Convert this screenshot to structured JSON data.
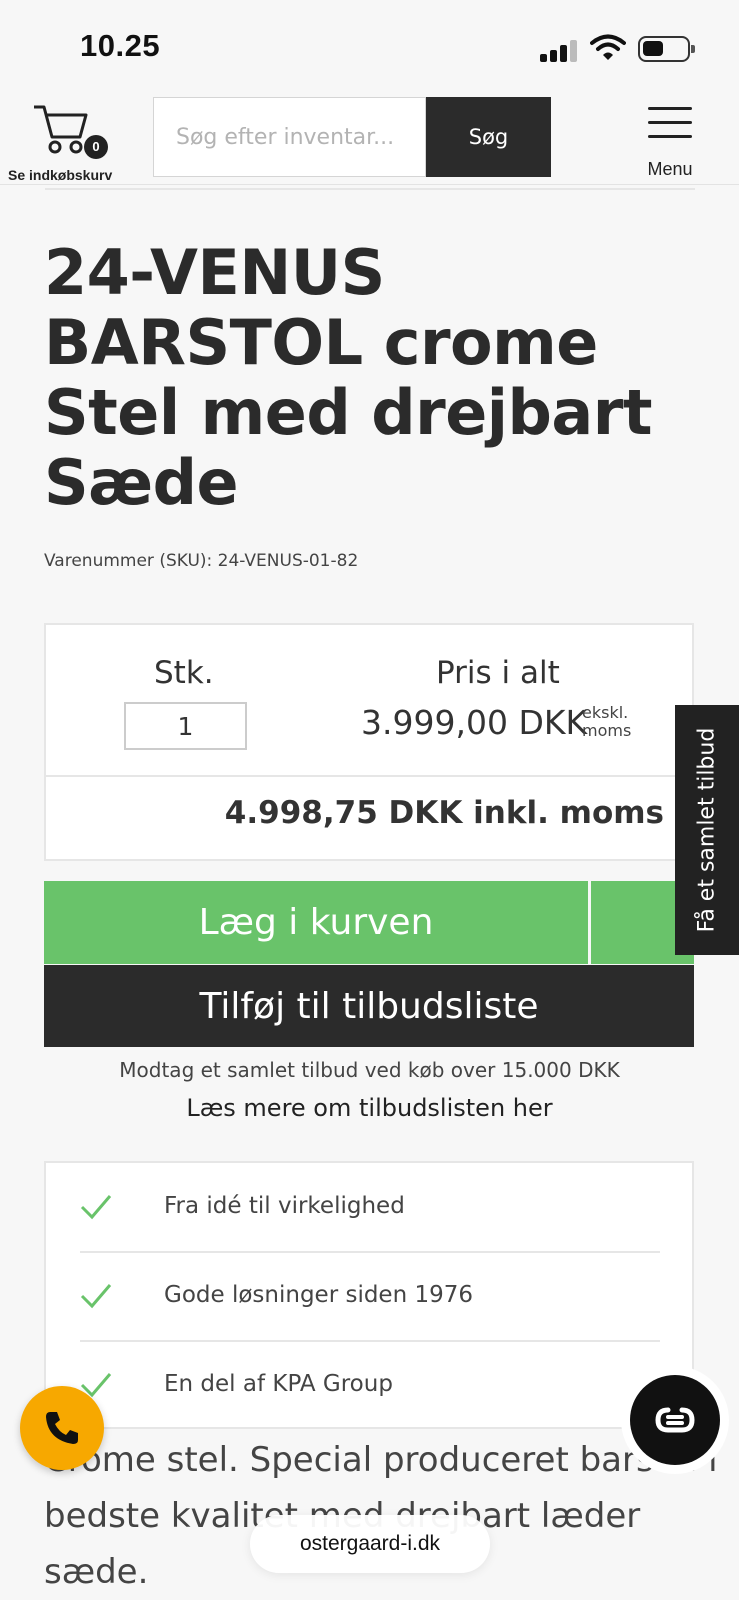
{
  "status_bar": {
    "time": "10.25"
  },
  "header": {
    "cart_count": "0",
    "cart_label": "Se indkøbskurv",
    "search_placeholder": "Søg efter inventar...",
    "search_button": "Søg",
    "menu_label": "Menu"
  },
  "product": {
    "title": "24-VENUS BARSTOL crome Stel med drejbart Sæde",
    "sku": "Varenummer (SKU): 24-VENUS-01-82",
    "qty_label": "Stk.",
    "qty_value": "1",
    "total_label": "Pris i alt",
    "total_price": "3.999,00 DKK",
    "excl_label_1": "ekskl.",
    "excl_label_2": "moms",
    "incl_price": "4.998,75 DKK inkl. moms",
    "description": "Crome stel. Special produceret barstol i bedste kvalitet med drejbart læder sæde."
  },
  "actions": {
    "add_to_cart": "Læg i kurven",
    "add_to_quote": "Tilføj til tilbudsliste",
    "quote_note": "Modtag et samlet tilbud ved køb over 15.000 DKK",
    "quote_link": "Læs mere om tilbudslisten her"
  },
  "side_tab": {
    "label": "Få et samlet tilbud"
  },
  "benefits": [
    {
      "text": "Fra idé til virkelighed"
    },
    {
      "text": "Gode løsninger siden 1976"
    },
    {
      "text": "En del af KPA Group"
    }
  ],
  "browser": {
    "url": "ostergaard-i.dk"
  },
  "colors": {
    "accent_green": "#69c36a",
    "dark": "#2b2b2b",
    "phone_orange": "#f7a800"
  }
}
